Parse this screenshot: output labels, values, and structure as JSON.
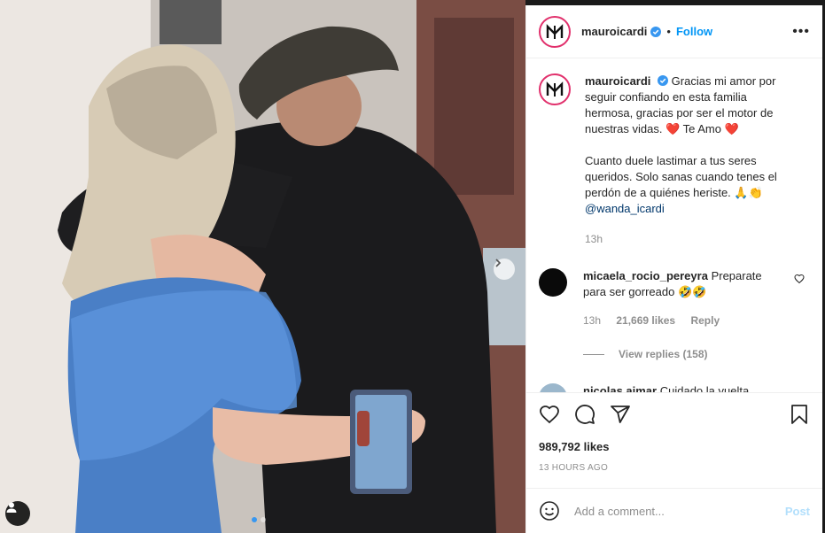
{
  "post": {
    "username": "mauroicardi",
    "follow_label": "Follow",
    "more_icon": "more-horizontal-icon",
    "caption_p1": "Gracias mi amor por seguir confiando en esta familia hermosa, gracias por ser el motor de nuestras vidas. ❤️ Te Amo ❤️",
    "caption_p2": "Cuanto duele lastimar a tus seres queridos. Solo sanas cuando tenes el perdón de a quiénes heriste. 🙏👏",
    "caption_mention": "@wanda_icardi",
    "caption_time": "13h",
    "likes": "989,792 likes",
    "timestamp": "13 HOURS AGO"
  },
  "comments": [
    {
      "username": "micaela_rocio_pereyra",
      "text": "Preparate para ser gorreado 🤣🤣",
      "time": "13h",
      "likes": "21,669 likes",
      "reply_label": "Reply",
      "view_replies": "View replies (158)"
    },
    {
      "username": "nicolas.aimar",
      "text": "Cuidado la vuelta"
    }
  ],
  "add_comment": {
    "placeholder": "Add a comment...",
    "post_label": "Post"
  },
  "colors": {
    "accent": "#0095f6",
    "verified": "#3897f0",
    "text": "#262626",
    "muted": "#8e8e8e"
  }
}
